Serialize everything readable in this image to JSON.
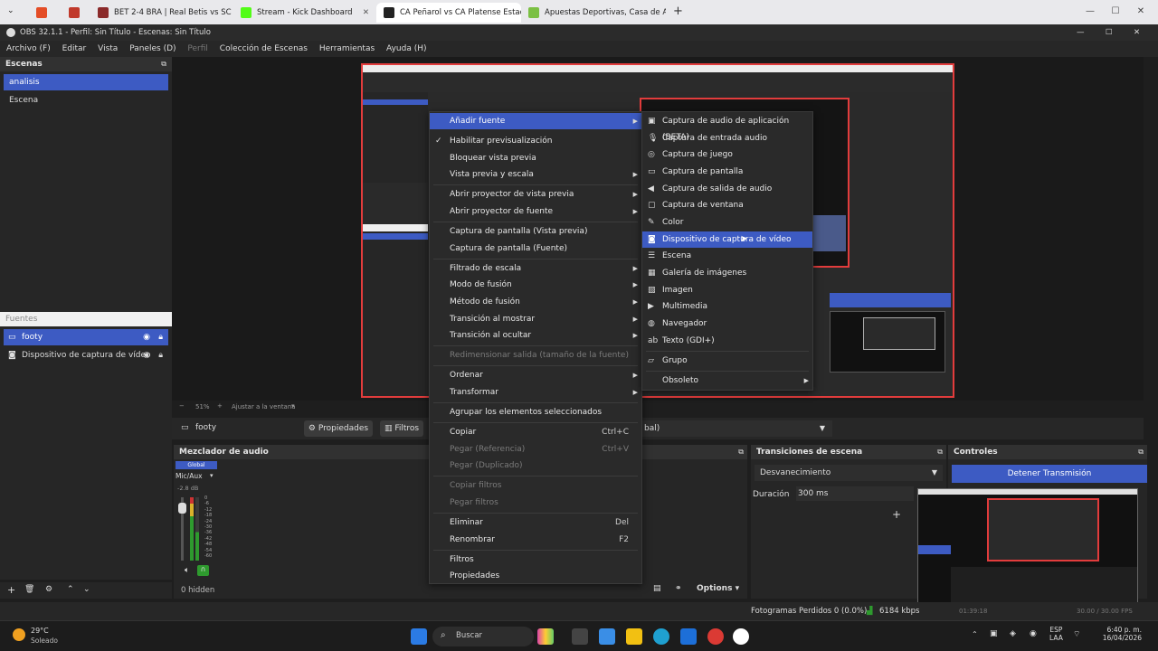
{
  "browser": {
    "tabs": [
      {
        "label": "BET 2-4 BRA | Real Betis vs SC Brag",
        "active": false
      },
      {
        "label": "Stream - Kick Dashboard",
        "active": false
      },
      {
        "label": "CA Peñarol vs CA Platense Estadísti",
        "active": true
      },
      {
        "label": "Apuestas Deportivas, Casa de Apu",
        "active": false
      }
    ],
    "new_tab": "+"
  },
  "obs": {
    "title": "OBS 32.1.1 - Perfil: Sin Título - Escenas: Sin Título",
    "menu": [
      "Archivo (F)",
      "Editar",
      "Vista",
      "Paneles (D)",
      "Perfil",
      "Colección de Escenas",
      "Herramientas",
      "Ayuda (H)"
    ],
    "scenes": {
      "header": "Escenas",
      "items": [
        "analisis",
        "Escena"
      ]
    },
    "sources": {
      "header": "Fuentes",
      "items": [
        "footy",
        "Dispositivo de captura de vídeo"
      ]
    },
    "zoom": {
      "percent": "51%",
      "fit": "Ajustar a la ventana"
    },
    "source_toolbar": {
      "name": "footy",
      "properties": "Propiedades",
      "filters": "Filtros",
      "dropdown_fragment": "bal)"
    },
    "mixer": {
      "header": "Mezclador de audio",
      "global_label": "Global",
      "channel": "Mic/Aux",
      "db": "-2.8 dB",
      "scale": [
        "0",
        "-6",
        "-12",
        "-18",
        "-24",
        "-30",
        "-36",
        "-42",
        "-48",
        "-54",
        "-60"
      ]
    },
    "hidden_count": "0 hidden",
    "options_label": "Options",
    "transitions": {
      "header": "Transiciones de escena",
      "selected": "Desvanecimiento",
      "duration_label": "Duración",
      "duration_value": "300 ms"
    },
    "controls": {
      "header": "Controles",
      "stop_button": "Detener Transmisión"
    },
    "status": {
      "dropped": "Fotogramas Perdidos 0 (0.0%)",
      "bitrate": "6184 kbps",
      "fps": "30.00 / 30.00 FPS",
      "time": "01:39:18"
    }
  },
  "context_menu": {
    "items": [
      {
        "label": "Añadir fuente",
        "submenu": true,
        "highlighted": true
      },
      {
        "label": "Habilitar previsualización",
        "checked": true
      },
      {
        "label": "Bloquear vista previa"
      },
      {
        "label": "Vista previa y escala",
        "submenu": true
      },
      {
        "label": "Abrir proyector de vista previa",
        "submenu": true
      },
      {
        "label": "Abrir proyector de fuente",
        "submenu": true
      },
      {
        "label": "Captura de pantalla (Vista previa)"
      },
      {
        "label": "Captura de pantalla (Fuente)"
      },
      {
        "label": "Filtrado de escala",
        "submenu": true
      },
      {
        "label": "Modo de fusión",
        "submenu": true
      },
      {
        "label": "Método de fusión",
        "submenu": true
      },
      {
        "label": "Transición al mostrar",
        "submenu": true
      },
      {
        "label": "Transición al ocultar",
        "submenu": true
      },
      {
        "label": "Redimensionar salida (tamaño de la fuente)",
        "disabled": true
      },
      {
        "label": "Ordenar",
        "submenu": true
      },
      {
        "label": "Transformar",
        "submenu": true
      },
      {
        "label": "Agrupar los elementos seleccionados"
      },
      {
        "label": "Copiar",
        "shortcut": "Ctrl+C"
      },
      {
        "label": "Pegar (Referencia)",
        "shortcut": "Ctrl+V",
        "disabled": true
      },
      {
        "label": "Pegar (Duplicado)",
        "disabled": true
      },
      {
        "label": "Copiar filtros",
        "disabled": true
      },
      {
        "label": "Pegar filtros",
        "disabled": true
      },
      {
        "label": "Eliminar",
        "shortcut": "Del"
      },
      {
        "label": "Renombrar",
        "shortcut": "F2"
      },
      {
        "label": "Filtros"
      },
      {
        "label": "Propiedades"
      }
    ]
  },
  "submenu": {
    "items": [
      {
        "label": "Captura de audio de aplicación (BETA)",
        "icon": "app-audio-icon"
      },
      {
        "label": "Captura de entrada audio",
        "icon": "microphone-icon"
      },
      {
        "label": "Captura de juego",
        "icon": "gamepad-icon"
      },
      {
        "label": "Captura de pantalla",
        "icon": "monitor-icon"
      },
      {
        "label": "Captura de salida de audio",
        "icon": "speaker-icon"
      },
      {
        "label": "Captura de ventana",
        "icon": "window-icon"
      },
      {
        "label": "Color",
        "icon": "brush-icon"
      },
      {
        "label": "Dispositivo de captura de vídeo",
        "icon": "camera-icon",
        "highlighted": true
      },
      {
        "label": "Escena",
        "icon": "list-icon"
      },
      {
        "label": "Galería de imágenes",
        "icon": "slideshow-icon"
      },
      {
        "label": "Imagen",
        "icon": "image-icon"
      },
      {
        "label": "Multimedia",
        "icon": "play-icon"
      },
      {
        "label": "Navegador",
        "icon": "globe-icon"
      },
      {
        "label": "Texto (GDI+)",
        "icon": "text-icon"
      },
      {
        "label": "Grupo",
        "icon": "folder-icon"
      },
      {
        "label": "Obsoleto",
        "submenu": true
      }
    ]
  },
  "taskbar": {
    "weather_temp": "29°C",
    "weather_desc": "Soleado",
    "search": "Buscar",
    "lang": "ESP",
    "region": "LAA",
    "time": "6:40 p. m.",
    "date": "16/04/2026"
  },
  "colors": {
    "accent": "#3d5bc3",
    "capture_border": "#e23c3c"
  }
}
